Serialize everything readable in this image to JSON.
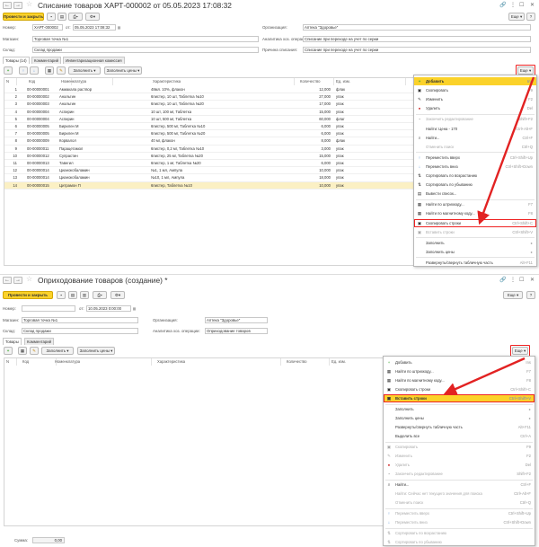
{
  "colors": {
    "accent": "#fbd22a",
    "highlight": "#e22222",
    "selected_row": "#fbf0c4",
    "add_green": "#3ba82f"
  },
  "doc1": {
    "title": "Списание товаров ХАРТ-000002 от 05.05.2023 17:08:32",
    "post_close": "Провести и закрыть",
    "more": "Еще",
    "number_label": "Номер:",
    "number": "ХАРТ-000002",
    "date_label": "от:",
    "date": "05.05.2023 17:08:32",
    "org_label": "Организация:",
    "org": "Аптека \"Здоровье\"",
    "shop_label": "Магазин:",
    "shop": "Торговая точка №1",
    "analytics_label": "Аналитика хоз. операции:",
    "analytics": "Списание при переходе на учет по серии",
    "warehouse_label": "Склад:",
    "warehouse": "Склад продажи",
    "reason_label": "Причина списания:",
    "reason": "Списание при переходе на учет по серии",
    "tabs": [
      "Товары (14)",
      "Комментарий",
      "Инвентаризационная комиссия"
    ],
    "fill_btn": "Заполнить",
    "fill_prices_btn": "Заполнить цены",
    "more2": "Еще",
    "columns": [
      "N",
      "Код",
      "Номенклатура",
      "Характеристика",
      "Количество",
      "Ед. изм."
    ],
    "rows": [
      [
        "1",
        "00-00000001",
        "Амиакала раствор",
        "48мл. 10%, флакон",
        "12,000",
        "флак"
      ],
      [
        "2",
        "00-00000002",
        "Анальгин",
        "6пистер, 10 шт, Таблетка №10",
        "27,000",
        "упак"
      ],
      [
        "3",
        "00-00000003",
        "Анальгин",
        "6пистер, 10 шт, Таблетка №20",
        "17,000",
        "упак"
      ],
      [
        "4",
        "00-00000004",
        "Аспирин",
        "10 шт, 100 мг, Таблетка",
        "15,000",
        "упак"
      ],
      [
        "5",
        "00-00000004",
        "Аспирин",
        "10 шт, 500 мг, Таблетка",
        "60,000",
        "флаг"
      ],
      [
        "6",
        "00-00000005",
        "Бирилен М",
        "6пистер, 500 мг, Таблетка №10",
        "6,000",
        "упак"
      ],
      [
        "7",
        "00-00000005",
        "Бирилен М",
        "6пистер, 500 мг, Таблетка №20",
        "6,000",
        "упак"
      ],
      [
        "8",
        "00-00000009",
        "Корвалол",
        "40 мг, флакон",
        "8,000",
        "флак"
      ],
      [
        "9",
        "00-00000011",
        "Парацетамол",
        "6пистер, 0,2 мг, Таблетка №10",
        "3,000",
        "упак"
      ],
      [
        "10",
        "00-00000012",
        "Супрастин",
        "6пистер, 25 мг, Таблетка №20",
        "15,000",
        "упак"
      ],
      [
        "11",
        "00-00000013",
        "Тавегил",
        "6пистер, 1 мг, Таблетка №20",
        "6,000",
        "упак"
      ],
      [
        "12",
        "00-00000014",
        "Цианокобаламин",
        "№1, 1 мл, Ампула",
        "10,000",
        "упак"
      ],
      [
        "13",
        "00-00000014",
        "Цианокобаламин",
        "№10, 1 мл, Ампула",
        "18,000",
        "упак"
      ],
      [
        "14",
        "00-00000015",
        "Цитрамон П",
        "6пистер, Таблетка №10",
        "10,000",
        "упак"
      ]
    ],
    "menu": [
      {
        "icon": "+",
        "label": "Добавить",
        "shortcut": "Ins",
        "state": "hl"
      },
      {
        "icon": "▣",
        "label": "Скопировать",
        "shortcut": "F9",
        "state": ""
      },
      {
        "icon": "✎",
        "label": "Изменить",
        "shortcut": "F2",
        "state": ""
      },
      {
        "icon": "●",
        "label": "Удалить",
        "shortcut": "Del",
        "state": ""
      },
      {
        "icon": "▪",
        "label": "Закончить редактирование",
        "shortcut": "Shift+F2",
        "state": "dis"
      },
      {
        "icon": "",
        "label": "Найти: Цена - 170",
        "shortcut": "Ctrl+Alt+F",
        "state": ""
      },
      {
        "icon": "⌕",
        "label": "Найти...",
        "shortcut": "Ctrl+F",
        "state": ""
      },
      {
        "icon": "",
        "label": "Отменить поиск",
        "shortcut": "Ctrl+Q",
        "state": "dis"
      },
      {
        "icon": "↑",
        "label": "Переместить вверх",
        "shortcut": "Ctrl+Shift+Up",
        "state": ""
      },
      {
        "icon": "↓",
        "label": "Переместить вниз",
        "shortcut": "Ctrl+Shift+Down",
        "state": ""
      },
      {
        "icon": "⇅",
        "label": "Сортировать по возрастанию",
        "shortcut": "",
        "state": ""
      },
      {
        "icon": "⇅",
        "label": "Сортировать по убыванию",
        "shortcut": "",
        "state": ""
      },
      {
        "icon": "▤",
        "label": "Вывести список...",
        "shortcut": "",
        "state": ""
      },
      {
        "icon": "▦",
        "label": "Найти по штрихкоду...",
        "shortcut": "F7",
        "state": ""
      },
      {
        "icon": "▦",
        "label": "Найти по магнитному коду...",
        "shortcut": "F8",
        "state": ""
      },
      {
        "icon": "▣",
        "label": "Скопировать строки",
        "shortcut": "Ctrl+Shift+C",
        "state": "box"
      },
      {
        "icon": "▣",
        "label": "Вставить строки",
        "shortcut": "Ctrl+Shift+V",
        "state": "dis"
      },
      {
        "icon": "",
        "label": "Заполнить",
        "shortcut": "▸",
        "state": ""
      },
      {
        "icon": "",
        "label": "Заполнить цены",
        "shortcut": "▸",
        "state": ""
      },
      {
        "icon": "",
        "label": "Развернуть/свернуть табличную часть",
        "shortcut": "Alt+F11",
        "state": ""
      }
    ]
  },
  "doc2": {
    "title": "Оприходование товаров (создание) *",
    "post_close": "Провести и закрыть",
    "more": "Еще",
    "number_label": "Номер:",
    "number": "",
    "date_label": "от:",
    "date": "10.05.2023 0:00:00",
    "shop_label": "Магазин:",
    "shop": "Торговая точка №1",
    "org_label": "Организация:",
    "org": "Аптека \"Здоровье\"",
    "warehouse_label": "Склад:",
    "warehouse": "Склад продажи",
    "analytics_label": "Аналитика хоз. операции:",
    "analytics": "Оприходование товаров",
    "tabs": [
      "Товары",
      "Комментарий"
    ],
    "fill_btn": "Заполнить",
    "fill_prices_btn": "Заполнить цены",
    "more2": "Еще",
    "columns": [
      "N",
      "Код",
      "Номенклатура",
      "Характеристика",
      "Количество",
      "Ед. изм."
    ],
    "sum_label": "Сумма:",
    "sum": "0,00",
    "menu": [
      {
        "icon": "+",
        "label": "Добавить",
        "shortcut": "Ins",
        "state": ""
      },
      {
        "icon": "▦",
        "label": "Найти по штрихкоду...",
        "shortcut": "F7",
        "state": ""
      },
      {
        "icon": "▦",
        "label": "Найти по магнитному коду...",
        "shortcut": "F8",
        "state": ""
      },
      {
        "icon": "▣",
        "label": "Скопировать строки",
        "shortcut": "Ctrl+Shift+C",
        "state": ""
      },
      {
        "icon": "▣",
        "label": "Вставить строки",
        "shortcut": "Ctrl+Shift+V",
        "state": "hl"
      },
      {
        "icon": "",
        "label": "Заполнить",
        "shortcut": "▸",
        "state": ""
      },
      {
        "icon": "",
        "label": "Заполнить цены",
        "shortcut": "▸",
        "state": ""
      },
      {
        "icon": "",
        "label": "Развернуть/свернуть табличную часть",
        "shortcut": "Alt+F11",
        "state": ""
      },
      {
        "icon": "",
        "label": "Выделить все",
        "shortcut": "Ctrl+A",
        "state": ""
      },
      {
        "icon": "▣",
        "label": "Скопировать",
        "shortcut": "F9",
        "state": "dis"
      },
      {
        "icon": "✎",
        "label": "Изменить",
        "shortcut": "F2",
        "state": "dis"
      },
      {
        "icon": "●",
        "label": "Удалить",
        "shortcut": "Del",
        "state": "dis"
      },
      {
        "icon": "▪",
        "label": "Закончить редактирование",
        "shortcut": "Shift+F2",
        "state": "dis"
      },
      {
        "icon": "⌕",
        "label": "Найти...",
        "shortcut": "Ctrl+F",
        "state": ""
      },
      {
        "icon": "",
        "label": "Найти: Сейчас нет текущего значения для поиска",
        "shortcut": "Ctrl+Alt+F",
        "state": "dis"
      },
      {
        "icon": "",
        "label": "Отменить поиск",
        "shortcut": "Ctrl+Q",
        "state": "dis"
      },
      {
        "icon": "↑",
        "label": "Переместить вверх",
        "shortcut": "Ctrl+Shift+Up",
        "state": "dis"
      },
      {
        "icon": "↓",
        "label": "Переместить вниз",
        "shortcut": "Ctrl+Shift+Down",
        "state": "dis"
      },
      {
        "icon": "⇅",
        "label": "Сортировать по возрастанию",
        "shortcut": "",
        "state": "dis"
      },
      {
        "icon": "⇅",
        "label": "Сортировать по убыванию",
        "shortcut": "",
        "state": "dis"
      }
    ]
  }
}
